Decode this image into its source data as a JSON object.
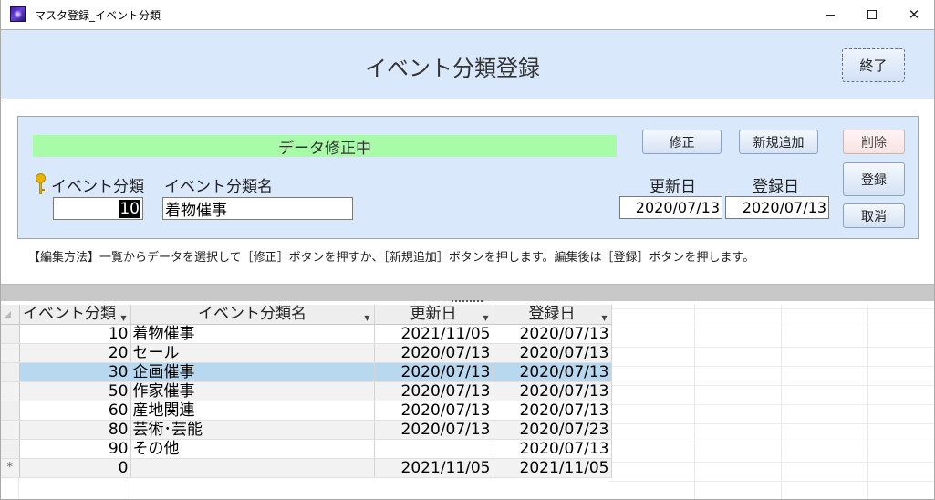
{
  "window": {
    "title": "マスタ登録_イベント分類",
    "minimize": "",
    "maximize": "",
    "close": "✕"
  },
  "header": {
    "title": "イベント分類登録",
    "exit_label": "終了"
  },
  "edit_panel": {
    "status": "データ修正中",
    "buttons": {
      "edit": "修正",
      "new": "新規追加",
      "delete": "削除",
      "register": "登録",
      "cancel": "取消"
    },
    "labels": {
      "category": "イベント分類",
      "category_name": "イベント分類名",
      "updated": "更新日",
      "registered": "登録日"
    },
    "values": {
      "category": "10",
      "category_name": "着物催事",
      "updated": "2020/07/13",
      "registered": "2020/07/13"
    }
  },
  "instructions": "【編集方法】一覧からデータを選択して［修正］ボタンを押すか、［新規追加］ボタンを押します。編集後は［登録］ボタンを押します。",
  "datasheet": {
    "columns": [
      "イベント分類",
      "イベント分類名",
      "更新日",
      "登録日"
    ],
    "rows": [
      {
        "cat": "10",
        "name": "着物催事",
        "updated": "2021/11/05",
        "registered": "2020/07/13"
      },
      {
        "cat": "20",
        "name": "セール",
        "updated": "2020/07/13",
        "registered": "2020/07/13"
      },
      {
        "cat": "30",
        "name": "企画催事",
        "updated": "2020/07/13",
        "registered": "2020/07/13"
      },
      {
        "cat": "50",
        "name": "作家催事",
        "updated": "2020/07/13",
        "registered": "2020/07/13"
      },
      {
        "cat": "60",
        "name": "産地関連",
        "updated": "2020/07/13",
        "registered": "2020/07/13"
      },
      {
        "cat": "80",
        "name": "芸術･芸能",
        "updated": "2020/07/13",
        "registered": "2020/07/23"
      },
      {
        "cat": "90",
        "name": "その他",
        "updated": "",
        "registered": "2020/07/13"
      }
    ],
    "new_row": {
      "marker": "*",
      "cat": "0",
      "name": "",
      "updated": "2021/11/05",
      "registered": "2021/11/05"
    },
    "selected_row_index": 2
  },
  "colors": {
    "header_band": "#dae8fc",
    "status_bar": "#a8fca8",
    "selected_row": "#b8d8f0"
  }
}
